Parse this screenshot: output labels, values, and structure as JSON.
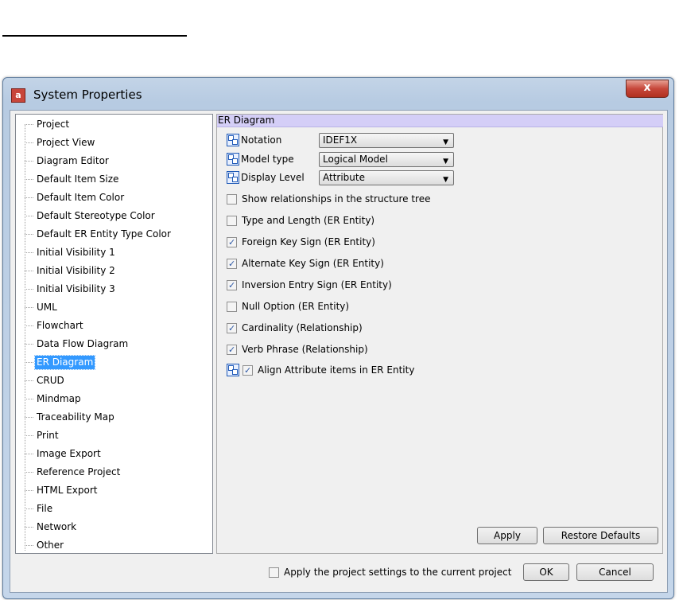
{
  "window": {
    "title": "System Properties",
    "app_icon": "astah-app-icon",
    "close_label": "x"
  },
  "tree": {
    "items": [
      "Project",
      "Project View",
      "Diagram Editor",
      "Default Item Size",
      "Default Item Color",
      "Default Stereotype Color",
      "Default ER Entity Type Color",
      "Initial Visibility 1",
      "Initial Visibility 2",
      "Initial Visibility 3",
      "UML",
      "Flowchart",
      "Data Flow Diagram",
      "ER Diagram",
      "CRUD",
      "Mindmap",
      "Traceability Map",
      "Print",
      "Image Export",
      "Reference Project",
      "HTML Export",
      "File",
      "Network",
      "Other"
    ],
    "selected": "ER Diagram"
  },
  "panel": {
    "header": "ER Diagram",
    "notation": {
      "label": "Notation",
      "value": "IDEF1X"
    },
    "model_type": {
      "label": "Model type",
      "value": "Logical Model"
    },
    "display_level": {
      "label": "Display Level",
      "value": "Attribute"
    },
    "checks": [
      {
        "label": "Show relationships in the structure tree",
        "checked": false
      },
      {
        "label": "Type and Length (ER Entity)",
        "checked": false
      },
      {
        "label": "Foreign Key Sign (ER Entity)",
        "checked": true
      },
      {
        "label": "Alternate Key Sign (ER Entity)",
        "checked": true
      },
      {
        "label": "Inversion Entry Sign (ER Entity)",
        "checked": true
      },
      {
        "label": "Null Option (ER Entity)",
        "checked": false
      },
      {
        "label": "Cardinality (Relationship)",
        "checked": true
      },
      {
        "label": "Verb Phrase (Relationship)",
        "checked": true
      },
      {
        "label": "Align Attribute items in ER Entity",
        "checked": true
      }
    ],
    "apply_label": "Apply",
    "restore_label": "Restore Defaults"
  },
  "footer": {
    "apply_project_label": "Apply the project settings to the current project",
    "apply_project_checked": false,
    "ok_label": "OK",
    "cancel_label": "Cancel"
  },
  "colors": {
    "selection": "#3399ff",
    "panel_header": "#d4cef7",
    "close_button": "#c6473a"
  }
}
